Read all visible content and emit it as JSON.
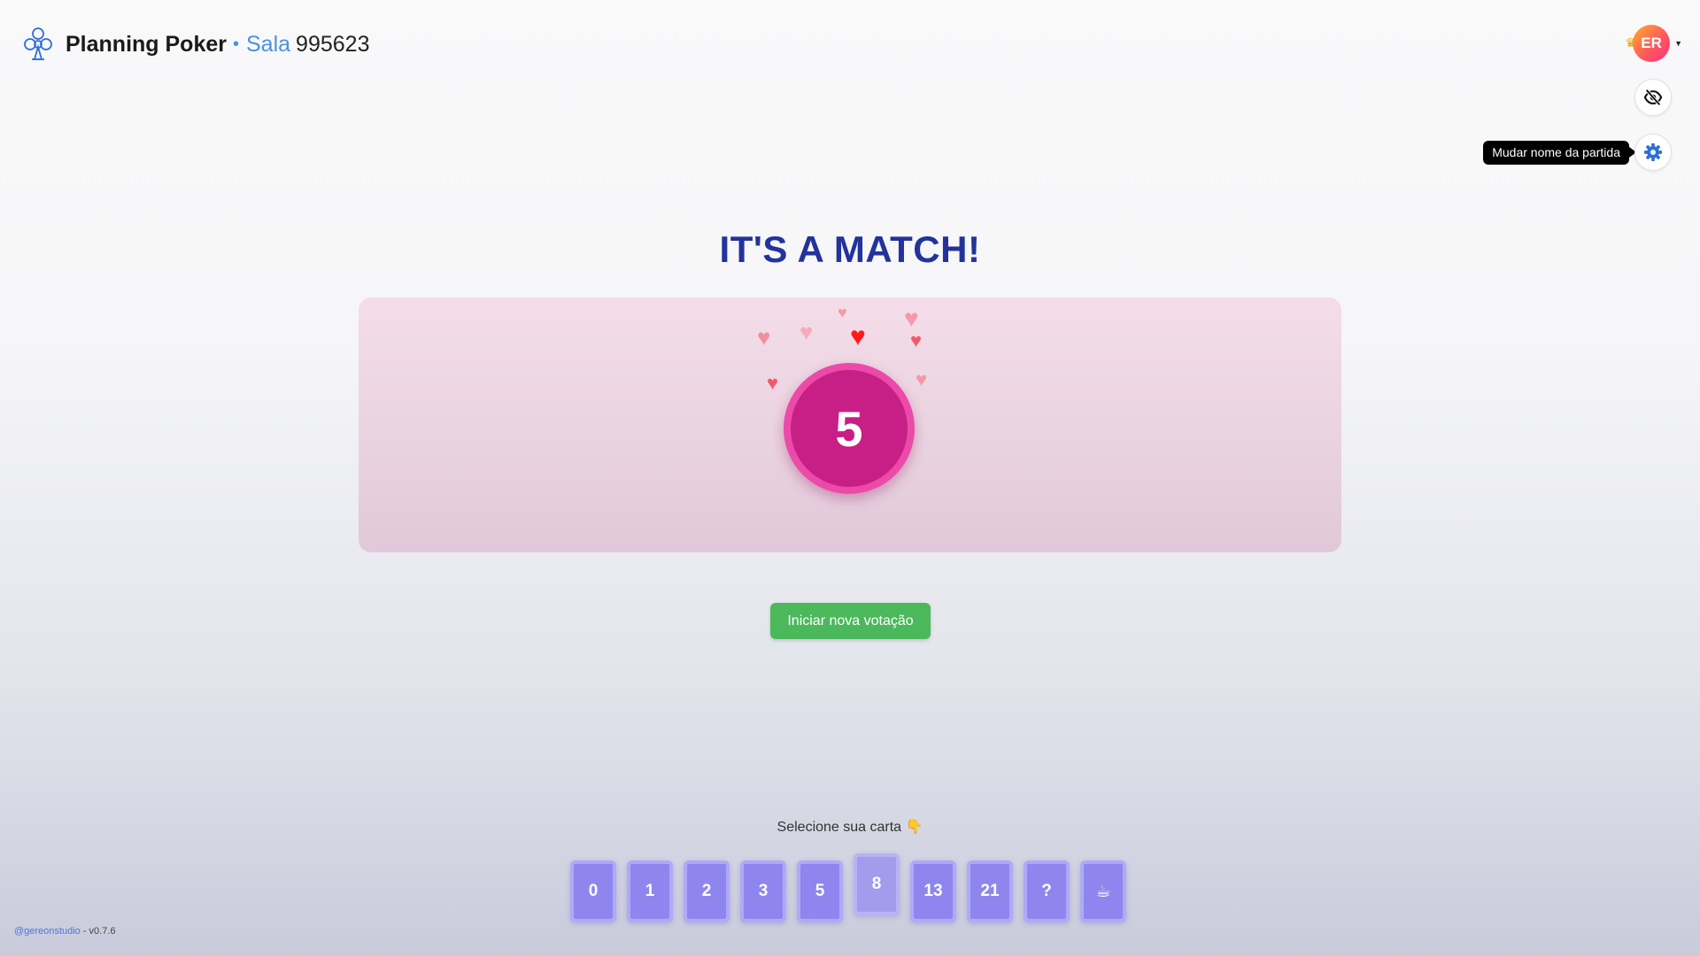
{
  "header": {
    "app_title": "Planning Poker",
    "separator": "•",
    "room_label": "Sala",
    "room_id": "995623"
  },
  "user": {
    "initials": "ER",
    "role_icon": "crown-icon"
  },
  "tooltip": "Mudar nome da partida",
  "match": {
    "title": "IT'S A MATCH!",
    "value": "5"
  },
  "actions": {
    "new_vote_label": "Iniciar nova votação"
  },
  "deck": {
    "prompt": "Selecione sua carta 👇",
    "cards": [
      "0",
      "1",
      "2",
      "3",
      "5",
      "8",
      "13",
      "21",
      "?",
      "☕"
    ],
    "selected": "8"
  },
  "footer": {
    "link": "@gereonstudio",
    "version": " - v0.7.6"
  },
  "colors": {
    "accent_blue": "#4a90e2",
    "title_navy": "#23339b",
    "match_circle": "#c81f86",
    "button_green": "#4cb85c",
    "card_purple": "#8e86ee"
  }
}
